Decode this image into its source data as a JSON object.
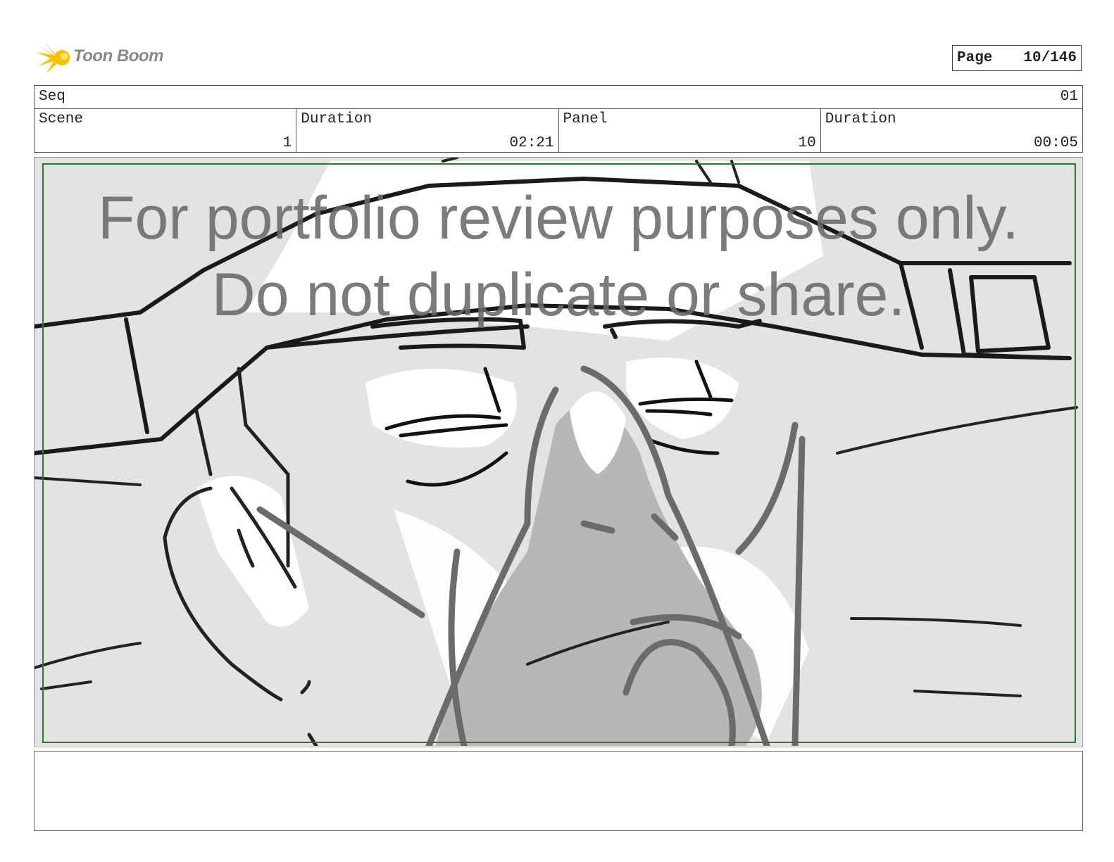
{
  "logo": {
    "text": "Toon Boom",
    "icon": "starburst-logo-icon",
    "accent": "#f5c400"
  },
  "page": {
    "label": "Page",
    "value": "10/146"
  },
  "header": {
    "seq": {
      "label": "Seq",
      "value": "01"
    },
    "scene": {
      "label": "Scene",
      "value": "1"
    },
    "scene_duration": {
      "label": "Duration",
      "value": "02:21"
    },
    "panel": {
      "label": "Panel",
      "value": "10"
    },
    "panel_duration": {
      "label": "Duration",
      "value": "00:05"
    }
  },
  "panel_image": {
    "watermark_line1": "For portfolio review purposes only.",
    "watermark_line2": "Do not duplicate or share.",
    "safe_frame_color": "#2d7a2d"
  },
  "notes": {
    "text": ""
  }
}
